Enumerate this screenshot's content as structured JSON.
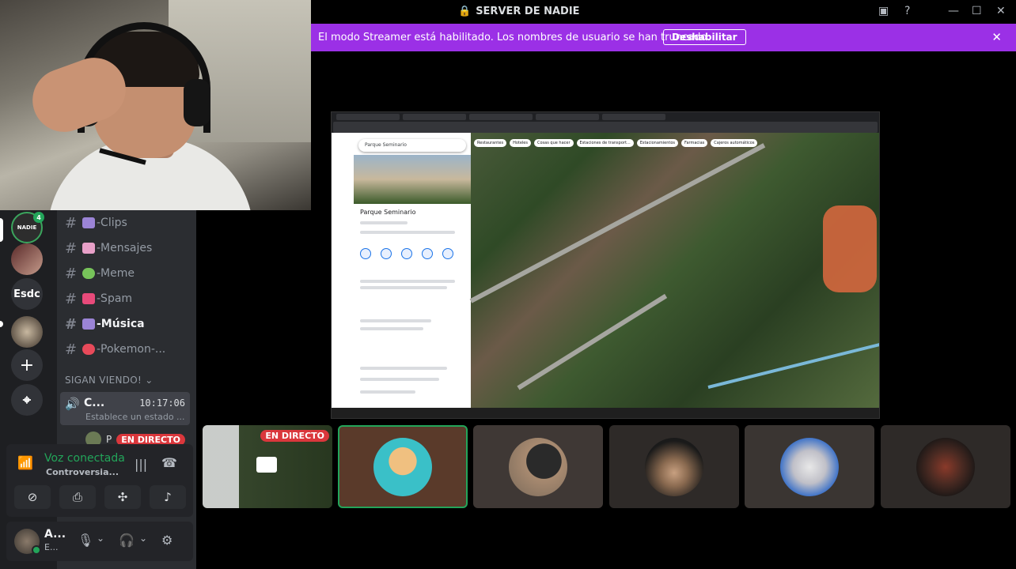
{
  "window": {
    "title": "SERVER DE NADIE"
  },
  "banner": {
    "text": "El modo Streamer está habilitado. Los nombres de usuario se han truncado.",
    "button": "Deshabilitar",
    "close_icon": "✕"
  },
  "servers": {
    "home_label": "NADIE",
    "home_badge": "4",
    "esdc_label": "Esdc",
    "add_icon": "+",
    "explore_icon": "⌖"
  },
  "channels": [
    {
      "label": "-Clips",
      "emoji_color": "#9b84d6"
    },
    {
      "label": "-Mensajes",
      "emoji_color": "#e8a0c8"
    },
    {
      "label": "-Meme",
      "emoji_color": "#77c35a"
    },
    {
      "label": "-Spam",
      "emoji_color": "#e84a7a"
    },
    {
      "label": "-Música",
      "emoji_color": "#9b84d6"
    },
    {
      "label": "-Pokemon-...",
      "emoji_color": "#e84a5a"
    }
  ],
  "category": "SIGAN VIENDO!",
  "voice_channel": {
    "name": "C...",
    "timer": "10:17:06",
    "status": "Establece un estado ..."
  },
  "live_user": {
    "name": "P",
    "badge": "EN DIRECTO"
  },
  "voice_panel": {
    "title": "Voz conectada",
    "channel": "Controversia..."
  },
  "user_panel": {
    "name": "A...",
    "status": "E..."
  },
  "shared_screen": {
    "search_text": "Parque Seminario",
    "place_name": "Parque Seminario",
    "chips": [
      "Restaurantes",
      "Hoteles",
      "Cosas que hacer",
      "Estaciones de transport...",
      "Estacionamientos",
      "Farmacias",
      "Cajeros automáticos"
    ]
  },
  "tiles": {
    "live_badge": "EN DIRECTO"
  },
  "colors": {
    "accent_purple": "#9b30e6",
    "online_green": "#23a55a",
    "live_red": "#da373c"
  }
}
